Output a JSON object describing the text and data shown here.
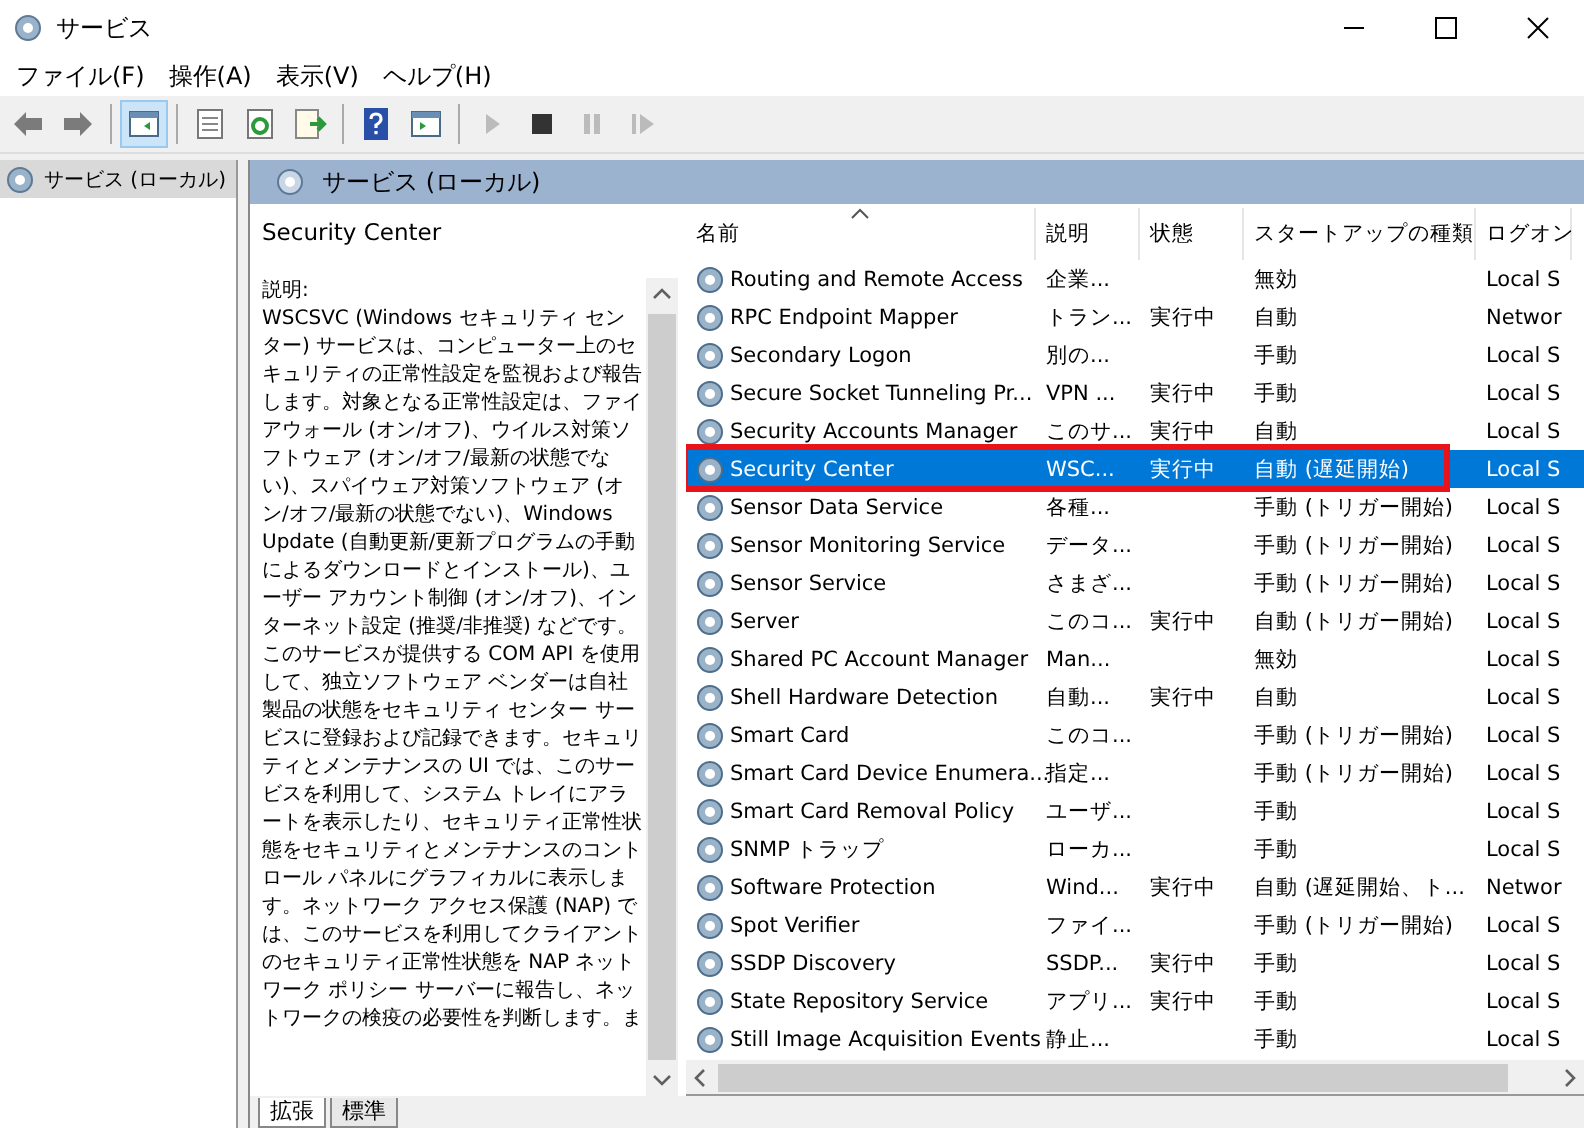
{
  "window": {
    "title": "サービス"
  },
  "menu": [
    "ファイル(F)",
    "操作(A)",
    "表示(V)",
    "ヘルプ(H)"
  ],
  "toolbar": [
    {
      "kind": "back",
      "pressed": false,
      "disabled": false
    },
    {
      "kind": "forward",
      "pressed": false,
      "disabled": false
    },
    {
      "kind": "sep"
    },
    {
      "kind": "tree",
      "pressed": true,
      "disabled": false
    },
    {
      "kind": "sep"
    },
    {
      "kind": "properties",
      "pressed": false,
      "disabled": false
    },
    {
      "kind": "refresh",
      "pressed": false,
      "disabled": false
    },
    {
      "kind": "export",
      "pressed": false,
      "disabled": false
    },
    {
      "kind": "sep"
    },
    {
      "kind": "help",
      "pressed": false,
      "disabled": false
    },
    {
      "kind": "view",
      "pressed": false,
      "disabled": false
    },
    {
      "kind": "sep"
    },
    {
      "kind": "start",
      "pressed": false,
      "disabled": true
    },
    {
      "kind": "stop",
      "pressed": false,
      "disabled": false
    },
    {
      "kind": "pause",
      "pressed": false,
      "disabled": true
    },
    {
      "kind": "resume",
      "pressed": false,
      "disabled": true
    }
  ],
  "tree": {
    "items": [
      {
        "label": "サービス (ローカル)",
        "selected": true
      }
    ]
  },
  "panel_header": "サービス (ローカル)",
  "details": {
    "title": "Security Center",
    "label": "説明:",
    "description": "WSCSVC (Windows セキュリティ センター) サービスは、コンピューター上のセキュリティの正常性設定を監視および報告します。対象となる正常性設定は、ファイアウォール (オン/オフ)、ウイルス対策ソフトウェア (オン/オフ/最新の状態でない)、スパイウェア対策ソフトウェア (オン/オフ/最新の状態でない)、Windows Update (自動更新/更新プログラムの手動によるダウンロードとインストール)、ユーザー アカウント制御 (オン/オフ)、インターネット設定 (推奨/非推奨) などです。このサービスが提供する COM API を使用して、独立ソフトウェア ベンダーは自社製品の状態をセキュリティ センター サービスに登録および記録できます。セキュリティとメンテナンスの UI では、このサービスを利用して、システム トレイにアラートを表示したり、セキュリティ正常性状態をセキュリティとメンテナンスのコントロール パネルにグラフィカルに表示します。ネットワーク アクセス保護 (NAP) では、このサービスを利用してクライアントのセキュリティ正常性状態を NAP ネットワーク ポリシー サーバーに報告し、ネットワークの検疫の必要性を判断します。ま"
  },
  "table": {
    "columns": [
      {
        "label": "名前",
        "sorted": true
      },
      {
        "label": "説明",
        "sorted": false
      },
      {
        "label": "状態",
        "sorted": false
      },
      {
        "label": "スタートアップの種類",
        "sorted": false
      },
      {
        "label": "ログオン",
        "sorted": false
      }
    ],
    "rows": [
      {
        "name": "Routing and Remote Access",
        "description": "企業...",
        "status": "",
        "startup": "無効",
        "logon": "Local S",
        "selected": false,
        "highlighted": false
      },
      {
        "name": "RPC Endpoint Mapper",
        "description": "トラン...",
        "status": "実行中",
        "startup": "自動",
        "logon": "Networ",
        "selected": false,
        "highlighted": false
      },
      {
        "name": "Secondary Logon",
        "description": "別の...",
        "status": "",
        "startup": "手動",
        "logon": "Local S",
        "selected": false,
        "highlighted": false
      },
      {
        "name": "Secure Socket Tunneling Pr...",
        "description": "VPN ...",
        "status": "実行中",
        "startup": "手動",
        "logon": "Local S",
        "selected": false,
        "highlighted": false
      },
      {
        "name": "Security Accounts Manager",
        "description": "このサ...",
        "status": "実行中",
        "startup": "自動",
        "logon": "Local S",
        "selected": false,
        "highlighted": false
      },
      {
        "name": "Security Center",
        "description": "WSC...",
        "status": "実行中",
        "startup": "自動 (遅延開始)",
        "logon": "Local S",
        "selected": true,
        "highlighted": true
      },
      {
        "name": "Sensor Data Service",
        "description": "各種...",
        "status": "",
        "startup": "手動 (トリガー開始)",
        "logon": "Local S",
        "selected": false,
        "highlighted": false
      },
      {
        "name": "Sensor Monitoring Service",
        "description": "データ...",
        "status": "",
        "startup": "手動 (トリガー開始)",
        "logon": "Local S",
        "selected": false,
        "highlighted": false
      },
      {
        "name": "Sensor Service",
        "description": "さまざ...",
        "status": "",
        "startup": "手動 (トリガー開始)",
        "logon": "Local S",
        "selected": false,
        "highlighted": false
      },
      {
        "name": "Server",
        "description": "このコ...",
        "status": "実行中",
        "startup": "自動 (トリガー開始)",
        "logon": "Local S",
        "selected": false,
        "highlighted": false
      },
      {
        "name": "Shared PC Account Manager",
        "description": "Man...",
        "status": "",
        "startup": "無効",
        "logon": "Local S",
        "selected": false,
        "highlighted": false
      },
      {
        "name": "Shell Hardware Detection",
        "description": "自動...",
        "status": "実行中",
        "startup": "自動",
        "logon": "Local S",
        "selected": false,
        "highlighted": false
      },
      {
        "name": "Smart Card",
        "description": "このコ...",
        "status": "",
        "startup": "手動 (トリガー開始)",
        "logon": "Local S",
        "selected": false,
        "highlighted": false
      },
      {
        "name": "Smart Card Device Enumera...",
        "description": "指定...",
        "status": "",
        "startup": "手動 (トリガー開始)",
        "logon": "Local S",
        "selected": false,
        "highlighted": false
      },
      {
        "name": "Smart Card Removal Policy",
        "description": "ユーザ...",
        "status": "",
        "startup": "手動",
        "logon": "Local S",
        "selected": false,
        "highlighted": false
      },
      {
        "name": "SNMP トラップ",
        "description": "ローカ...",
        "status": "",
        "startup": "手動",
        "logon": "Local S",
        "selected": false,
        "highlighted": false
      },
      {
        "name": "Software Protection",
        "description": "Wind...",
        "status": "実行中",
        "startup": "自動 (遅延開始、ト...",
        "logon": "Networ",
        "selected": false,
        "highlighted": false
      },
      {
        "name": "Spot Verifier",
        "description": "ファイ...",
        "status": "",
        "startup": "手動 (トリガー開始)",
        "logon": "Local S",
        "selected": false,
        "highlighted": false
      },
      {
        "name": "SSDP Discovery",
        "description": "SSDP...",
        "status": "実行中",
        "startup": "手動",
        "logon": "Local S",
        "selected": false,
        "highlighted": false
      },
      {
        "name": "State Repository Service",
        "description": "アプリ...",
        "status": "実行中",
        "startup": "手動",
        "logon": "Local S",
        "selected": false,
        "highlighted": false
      },
      {
        "name": "Still Image Acquisition Events",
        "description": "静止...",
        "status": "",
        "startup": "手動",
        "logon": "Local S",
        "selected": false,
        "highlighted": false
      }
    ]
  },
  "view_tabs": [
    {
      "label": "拡張",
      "selected": true
    },
    {
      "label": "標準",
      "selected": false
    }
  ]
}
